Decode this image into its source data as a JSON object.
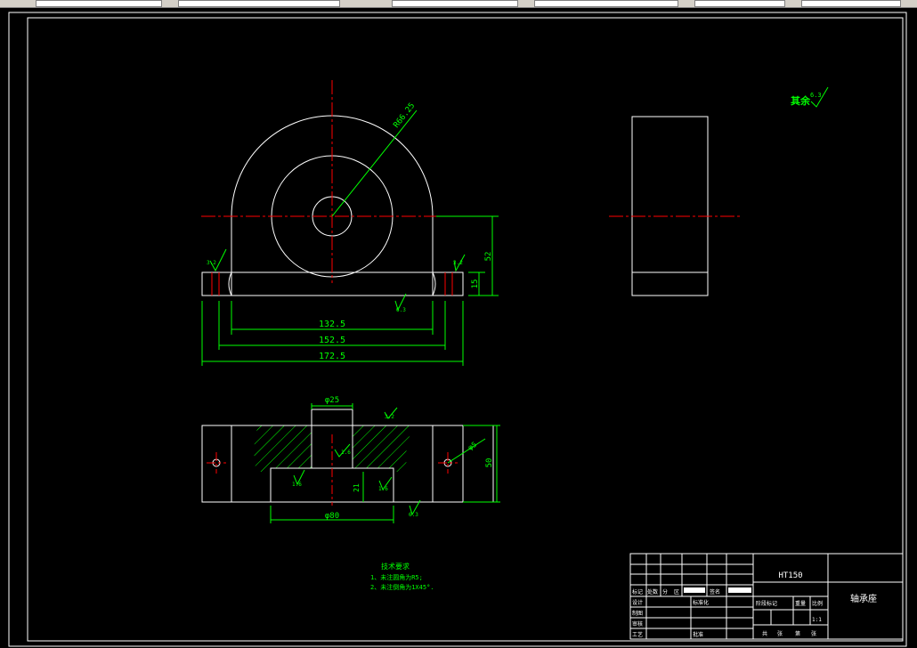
{
  "colors": {
    "background": "#000000",
    "outline": "#ffffff",
    "dimension": "#00ff00",
    "centerline": "#ff0000",
    "text": "#00ff00",
    "toolbar": "#d4d0c8"
  },
  "dimensions": {
    "radius": "R66.25",
    "width_inner": "132.5",
    "width_mid": "152.5",
    "width_outer": "172.5",
    "height_total": "52",
    "height_base": "15",
    "bore_top": "φ25",
    "bore_bottom": "φ80",
    "hole_dia": "φ5",
    "plan_height": "50",
    "depth": "21"
  },
  "roughness": {
    "corner_label": "其余",
    "corner_value": "6.3",
    "left_flange": "3.2",
    "right_flange": "3.2",
    "base": "6.3",
    "plan_center": "1.6",
    "plan_left": "1.6",
    "plan_right": "1.6",
    "plan_top": "3.2",
    "plan_bottom": "6.3"
  },
  "notes": {
    "title": "技术要求",
    "line1": "1、未注圆角为R5;",
    "line2": "2、未注倒角为1X45°."
  },
  "title_block": {
    "material": "HT150",
    "part_name": "轴承座",
    "scale": "1:1",
    "labels": {
      "mark": "标记",
      "count": "处数",
      "zone": "分",
      "area": "区",
      "sign": "签名",
      "design": "设计",
      "standardize": "标准化",
      "drafting": "制图",
      "review": "审核",
      "process": "工艺",
      "approve": "批准",
      "stage_mark": "阶段标记",
      "weight": "重量",
      "ratio": "比例",
      "sheet_total": "共",
      "sheet": "张",
      "sheet_of": "第",
      "sheet2": "张"
    }
  }
}
